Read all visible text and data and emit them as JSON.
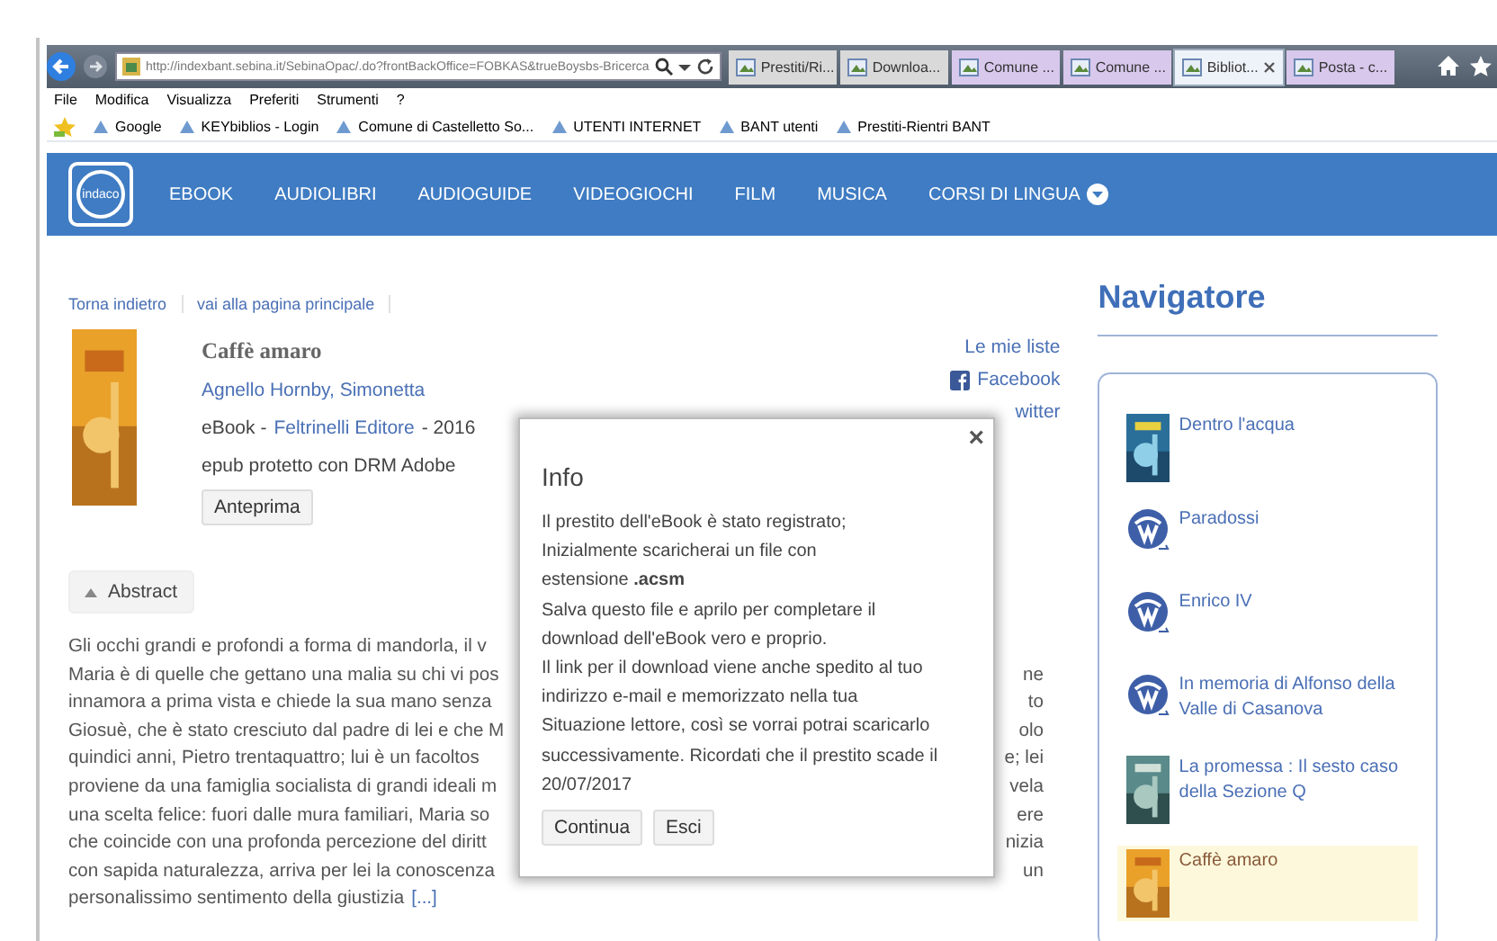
{
  "browser": {
    "url": "http://indexbant.sebina.it/SebinaOpac/.do?frontBackOffice=FOBKAS&trueBoysbs-Bricerca",
    "tabs": [
      {
        "label": "Prestiti/Ri...",
        "selected": false,
        "color": "#d9d9d9"
      },
      {
        "label": "Downloa...",
        "selected": false,
        "color": "#d9d9d9"
      },
      {
        "label": "Comune ...",
        "selected": false,
        "color": "#d8c8ec"
      },
      {
        "label": "Comune ...",
        "selected": false,
        "color": "#d8c8ec"
      },
      {
        "label": "Bibliot...",
        "selected": true,
        "color": "#eef3fa"
      },
      {
        "label": "Posta - c...",
        "selected": false,
        "color": "#d8c8ec"
      }
    ],
    "menu": [
      "File",
      "Modifica",
      "Visualizza",
      "Preferiti",
      "Strumenti",
      "?"
    ],
    "favorites": [
      "Google",
      "KEYbiblios - Login",
      "Comune di Castelletto So...",
      "UTENTI INTERNET",
      "BANT utenti",
      "Prestiti-Rientri BANT"
    ]
  },
  "site_nav": {
    "logo_text": "indaco",
    "items": [
      {
        "label": "EBOOK",
        "dropdown": false
      },
      {
        "label": "AUDIOLIBRI",
        "dropdown": false
      },
      {
        "label": "AUDIOGUIDE",
        "dropdown": false
      },
      {
        "label": "VIDEOGIOCHI",
        "dropdown": false
      },
      {
        "label": "FILM",
        "dropdown": false
      },
      {
        "label": "MUSICA",
        "dropdown": false
      },
      {
        "label": "CORSI DI LINGUA",
        "dropdown": true
      }
    ]
  },
  "breadcrumb": [
    "Torna indietro",
    "vai alla pagina principale"
  ],
  "book": {
    "title": "Caffè amaro",
    "author": "Agnello Hornby, Simonetta",
    "type": "eBook -",
    "publisher": "Feltrinelli Editore",
    "year": "- 2016",
    "format": "epub protetto con DRM Adobe",
    "preview_button": "Anteprima"
  },
  "share_links": [
    {
      "label": "Le mie liste",
      "kind": "text"
    },
    {
      "label": "Facebook",
      "kind": "facebook"
    },
    {
      "label": "witter",
      "kind": "text"
    }
  ],
  "abstract": {
    "toggle": "Abstract",
    "expanded": true,
    "lines": [
      {
        "left": "Gli occhi grandi e profondi a forma di mandorla, il v"
      },
      {
        "left": "Maria è di quelle che gettano una malia su chi vi pos",
        "right": "ne"
      },
      {
        "left": "innamora a prima vista e chiede la sua mano senza",
        "right": "to"
      },
      {
        "left": "Giosuè, che è stato cresciuto dal padre di lei e che M",
        "right": "olo"
      },
      {
        "left": "quindici anni, Pietro trentaquattro; lui è un facoltos",
        "right": "e; lei"
      },
      {
        "left": "proviene da una famiglia socialista di grandi ideali m",
        "right": "vela"
      },
      {
        "left": "una scelta felice: fuori dalle mura familiari, Maria so",
        "right": "ere"
      },
      {
        "left": "che coincide con una profonda percezione del diritt",
        "right": "nizia"
      },
      {
        "left": "con sapida naturalezza, arriva per lei la conoscenza",
        "right": "un"
      },
      {
        "left": "personalissimo sentimento della giustizia"
      }
    ],
    "more_link": "[...]"
  },
  "dialog": {
    "title": "Info",
    "close": "×",
    "lines": [
      "Il prestito dell'eBook è stato registrato;",
      "Inizialmente scaricherai un file con",
      "estensione **.acsm**",
      "Salva questo file e aprilo per completare il",
      "download dell'eBook vero e proprio.",
      "Il link per il download viene anche spedito al tuo",
      "indirizzo e-mail e memorizzato nella tua",
      "Situazione lettore, così se vorrai potrai scaricarlo",
      "successivamente. Ricordati che il prestito scade il",
      "20/07/2017"
    ],
    "buttons": [
      "Continua",
      "Esci"
    ]
  },
  "navigator": {
    "title": "Navigatore",
    "items": [
      {
        "label": "Dentro l'acqua",
        "kind": "cover",
        "selected": false
      },
      {
        "label": "Paradossi",
        "kind": "logo",
        "selected": false
      },
      {
        "label": "Enrico IV",
        "kind": "logo",
        "selected": false
      },
      {
        "label": "In memoria di Alfonso della Valle di Casanova",
        "kind": "logo",
        "selected": false
      },
      {
        "label": "La promessa : Il sesto caso della Sezione Q",
        "kind": "cover",
        "selected": false
      },
      {
        "label": "Caffè amaro",
        "kind": "cover",
        "selected": true
      }
    ]
  }
}
